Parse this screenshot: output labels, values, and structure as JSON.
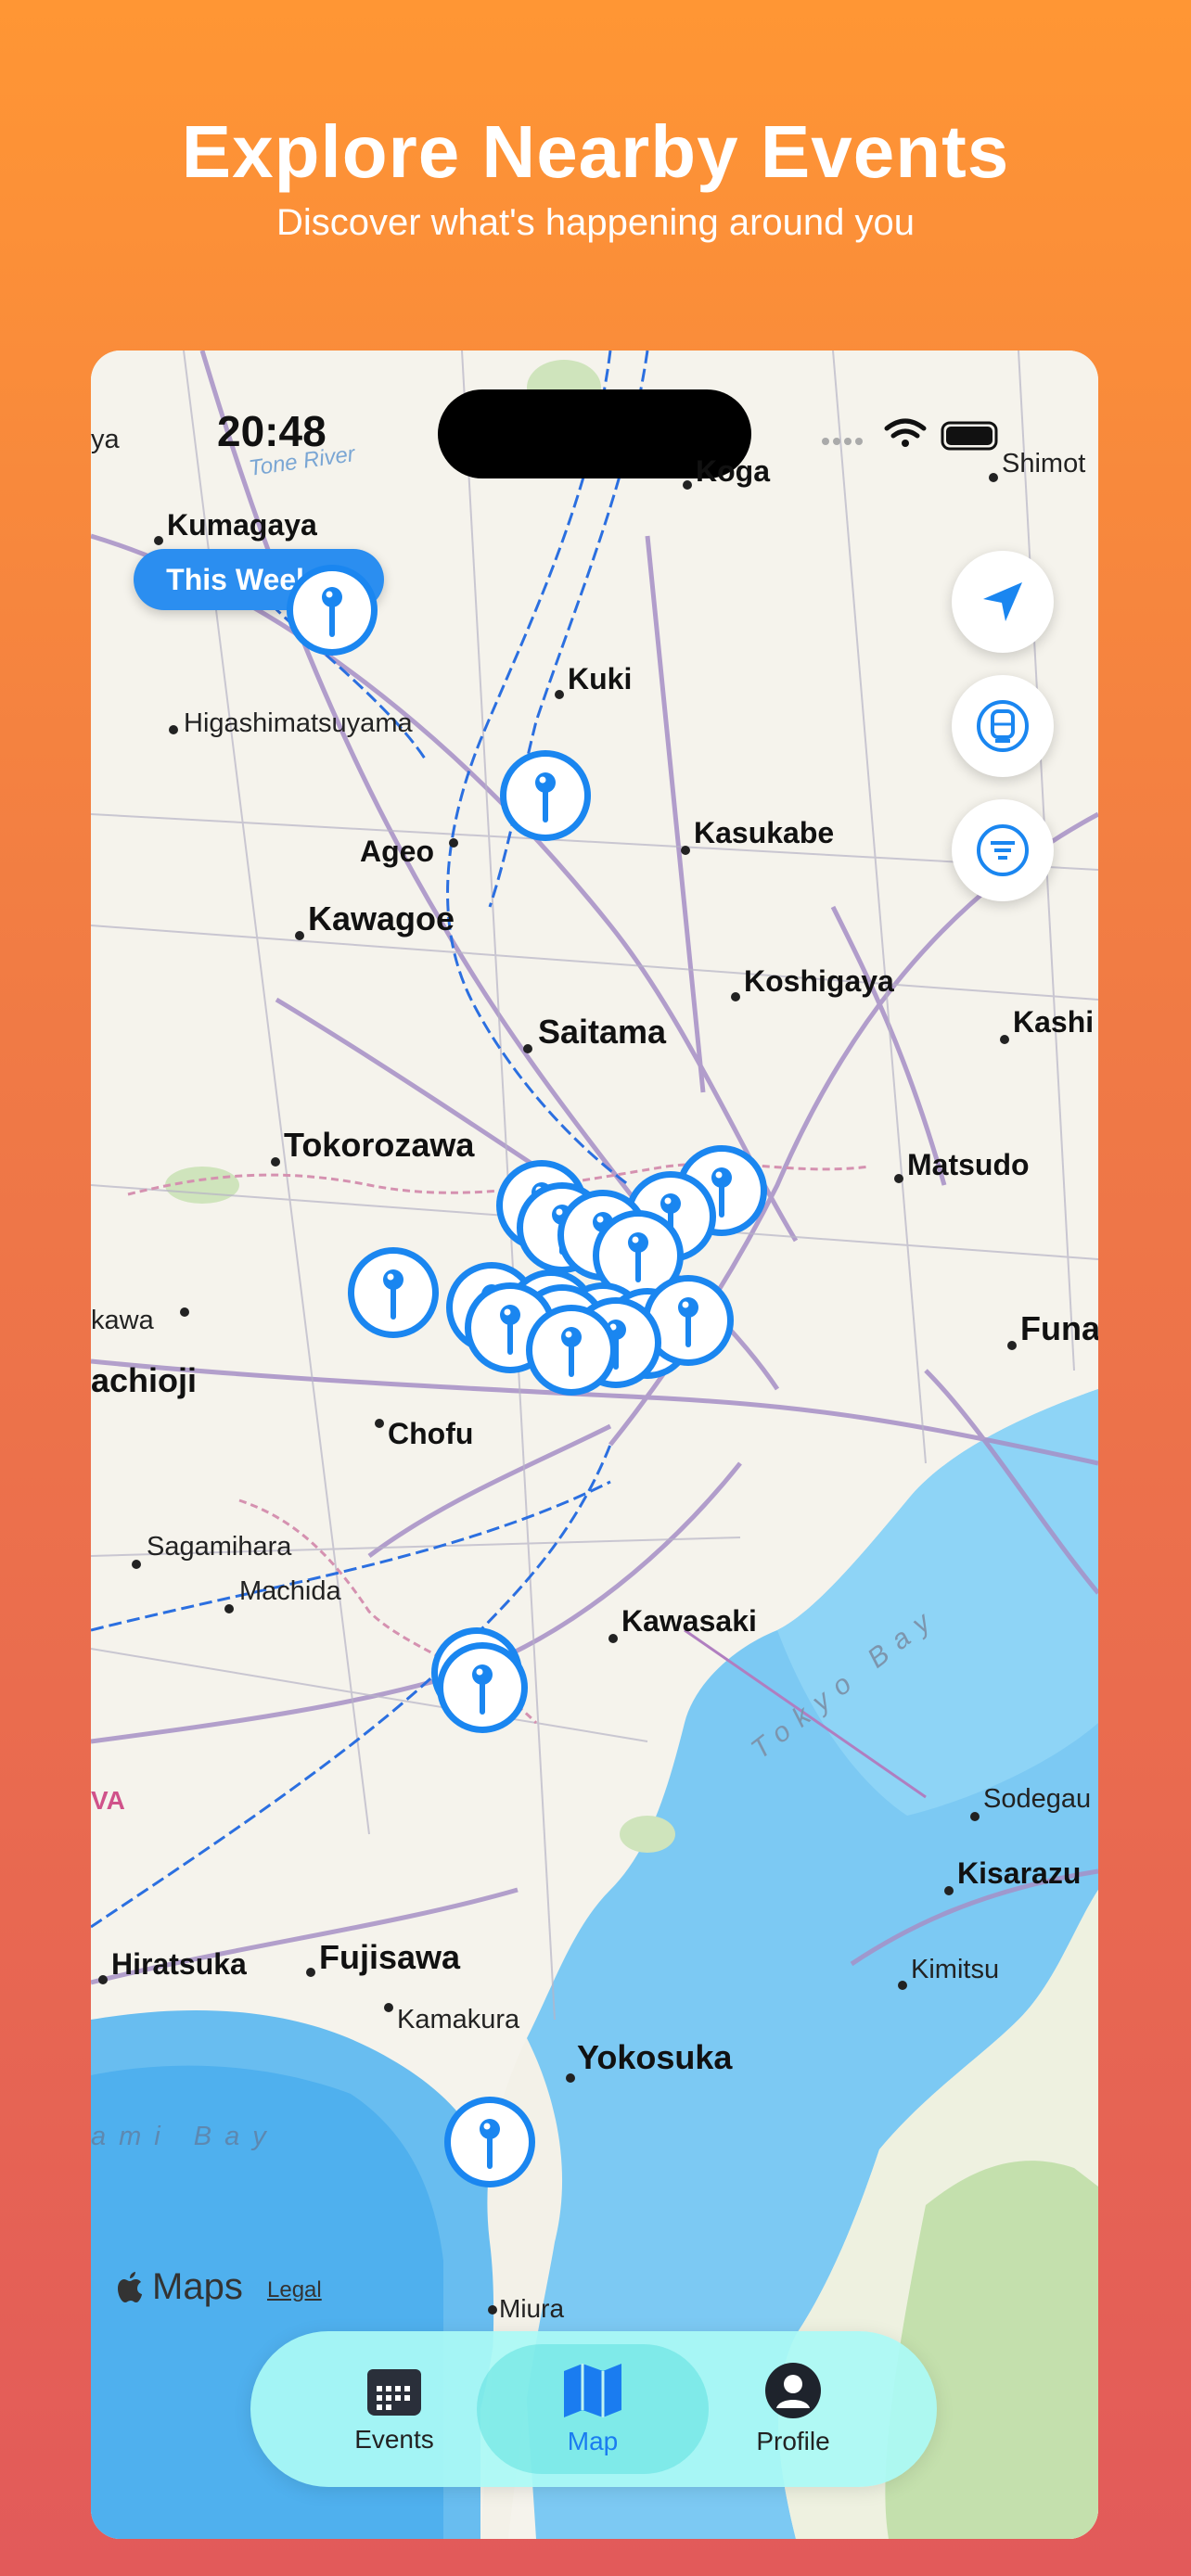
{
  "hero": {
    "title": "Explore Nearby Events",
    "subtitle": "Discover what's happening around you"
  },
  "status": {
    "time": "20:48"
  },
  "filter": {
    "label": "This Week"
  },
  "map": {
    "labels": {
      "kumagaya": "Kumagaya",
      "koga": "Koga",
      "shimot": "Shimot",
      "higashimatsuyama": "Higashimatsuyama",
      "kuki": "Kuki",
      "ageo": "Ageo",
      "kasukabe": "Kasukabe",
      "kawagoe": "Kawagoe",
      "koshigaya": "Koshigaya",
      "saitama": "Saitama",
      "kashi": "Kashi",
      "tokorozawa": "Tokorozawa",
      "matsudo": "Matsudo",
      "kawa": "kawa",
      "funa": "Funa",
      "achioji": "achioji",
      "chofu": "Chofu",
      "sagamihara": "Sagamihara",
      "machida": "Machida",
      "kawasaki": "Kawasaki",
      "sodegau": "Sodegau",
      "kisarazu": "Kisarazu",
      "kimitsu": "Kimitsu",
      "hiratsuka": "Hiratsuka",
      "fujisawa": "Fujisawa",
      "kamakura": "Kamakura",
      "yokosuka": "Yokosuka",
      "miura": "Miura",
      "ya": "ya",
      "va": "VA",
      "tone_river": "Tone River",
      "tokyo_bay": "Tokyo Bay",
      "ami_bay": "ami Bay"
    },
    "attribution": "Maps",
    "legal": "Legal"
  },
  "tabs": [
    {
      "label": "Events",
      "icon": "calendar-icon"
    },
    {
      "label": "Map",
      "icon": "map-icon"
    },
    {
      "label": "Profile",
      "icon": "profile-icon"
    }
  ],
  "colors": {
    "accent": "#1a86f0",
    "water": "#74c6f3",
    "land": "#f5f3ec"
  }
}
